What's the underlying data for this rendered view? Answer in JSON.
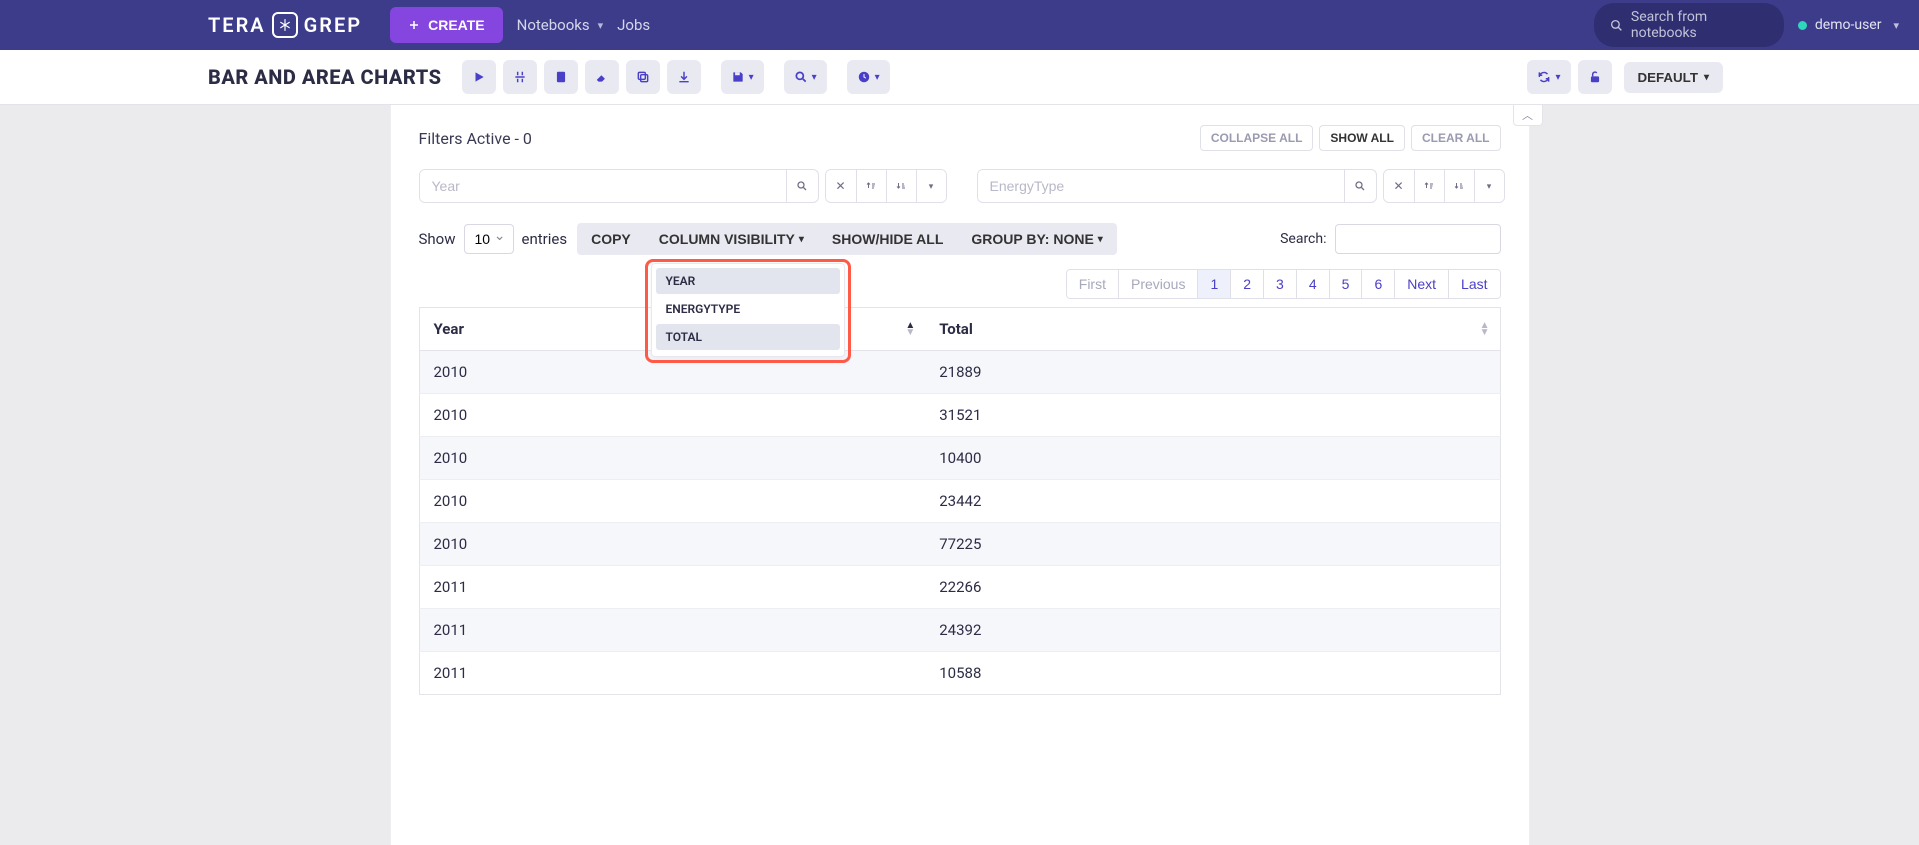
{
  "brand": {
    "left": "TERA",
    "right": "GREP"
  },
  "topbar": {
    "create_label": "CREATE",
    "nav": {
      "notebooks": "Notebooks",
      "jobs": "Jobs"
    },
    "search_placeholder": "Search from notebooks",
    "user": "demo-user"
  },
  "subheader": {
    "title": "BAR AND AREA CHARTS",
    "default_label": "DEFAULT"
  },
  "filters": {
    "label": "Filters Active - 0",
    "view_buttons": {
      "collapse_all": "COLLAPSE ALL",
      "show_all": "SHOW ALL",
      "clear_all": "CLEAR ALL"
    },
    "input1_placeholder": "Year",
    "input2_placeholder": "EnergyType"
  },
  "controls": {
    "show": "Show",
    "show_value": "10",
    "entries": "entries",
    "buttons": {
      "copy": "COPY",
      "column_visibility": "COLUMN VISIBILITY",
      "show_hide_all": "SHOW/HIDE ALL",
      "group_by": "GROUP BY: NONE"
    },
    "search_label": "Search:",
    "dropdown_items": [
      {
        "label": "YEAR",
        "selected": true
      },
      {
        "label": "ENERGYTYPE",
        "selected": false
      },
      {
        "label": "TOTAL",
        "selected": true
      }
    ]
  },
  "pagination": {
    "first": "First",
    "previous": "Previous",
    "pages": [
      "1",
      "2",
      "3",
      "4",
      "5",
      "6"
    ],
    "active": "1",
    "next": "Next",
    "last": "Last"
  },
  "table": {
    "headers": {
      "year": "Year",
      "total": "Total"
    },
    "rows": [
      {
        "year": "2010",
        "total": "21889"
      },
      {
        "year": "2010",
        "total": "31521"
      },
      {
        "year": "2010",
        "total": "10400"
      },
      {
        "year": "2010",
        "total": "23442"
      },
      {
        "year": "2010",
        "total": "77225"
      },
      {
        "year": "2011",
        "total": "22266"
      },
      {
        "year": "2011",
        "total": "24392"
      },
      {
        "year": "2011",
        "total": "10588"
      }
    ]
  }
}
